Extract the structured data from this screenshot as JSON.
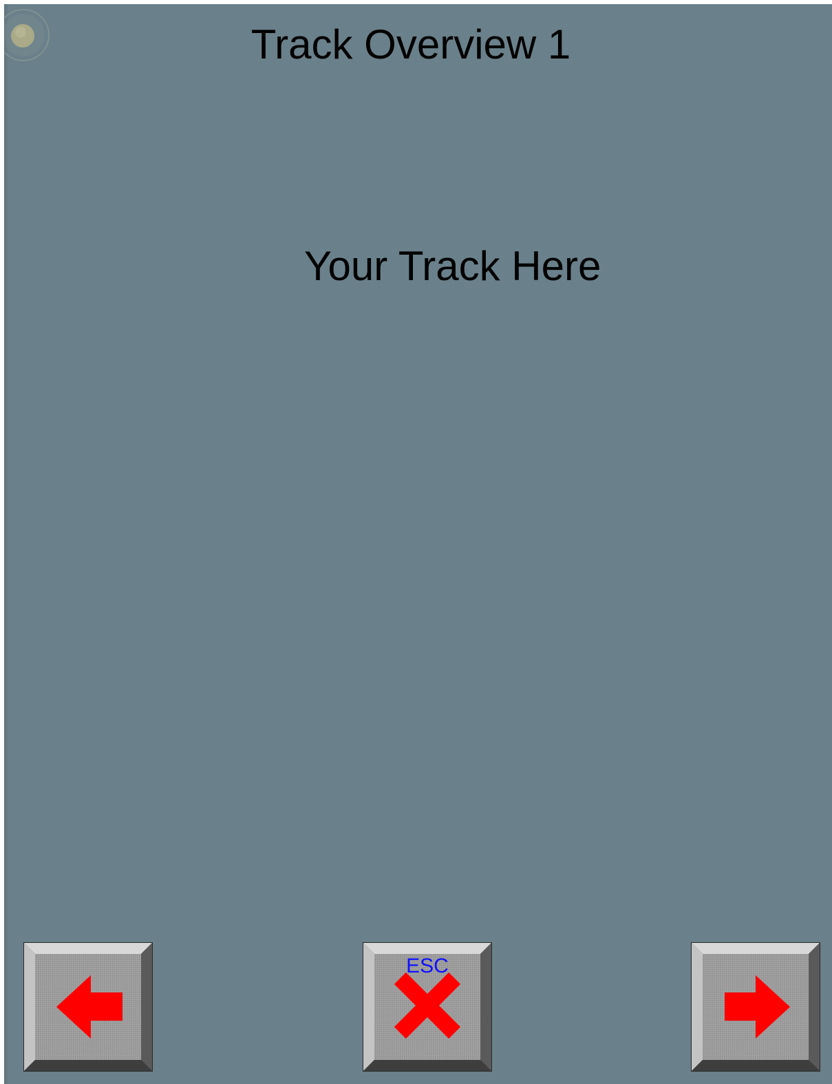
{
  "screen": {
    "title": "Track Overview 1",
    "placeholder": "Your Track Here"
  },
  "indicator": {
    "icon": "round-indicator-icon"
  },
  "nav": {
    "prev": {
      "icon": "arrow-left-icon"
    },
    "esc": {
      "label": "ESC",
      "icon": "close-x-icon"
    },
    "next": {
      "icon": "arrow-right-icon"
    }
  },
  "colors": {
    "background": "#6a808a",
    "arrow": "#ff0000",
    "esc_label": "#1010ff",
    "button_face": "#9a9a9a"
  }
}
